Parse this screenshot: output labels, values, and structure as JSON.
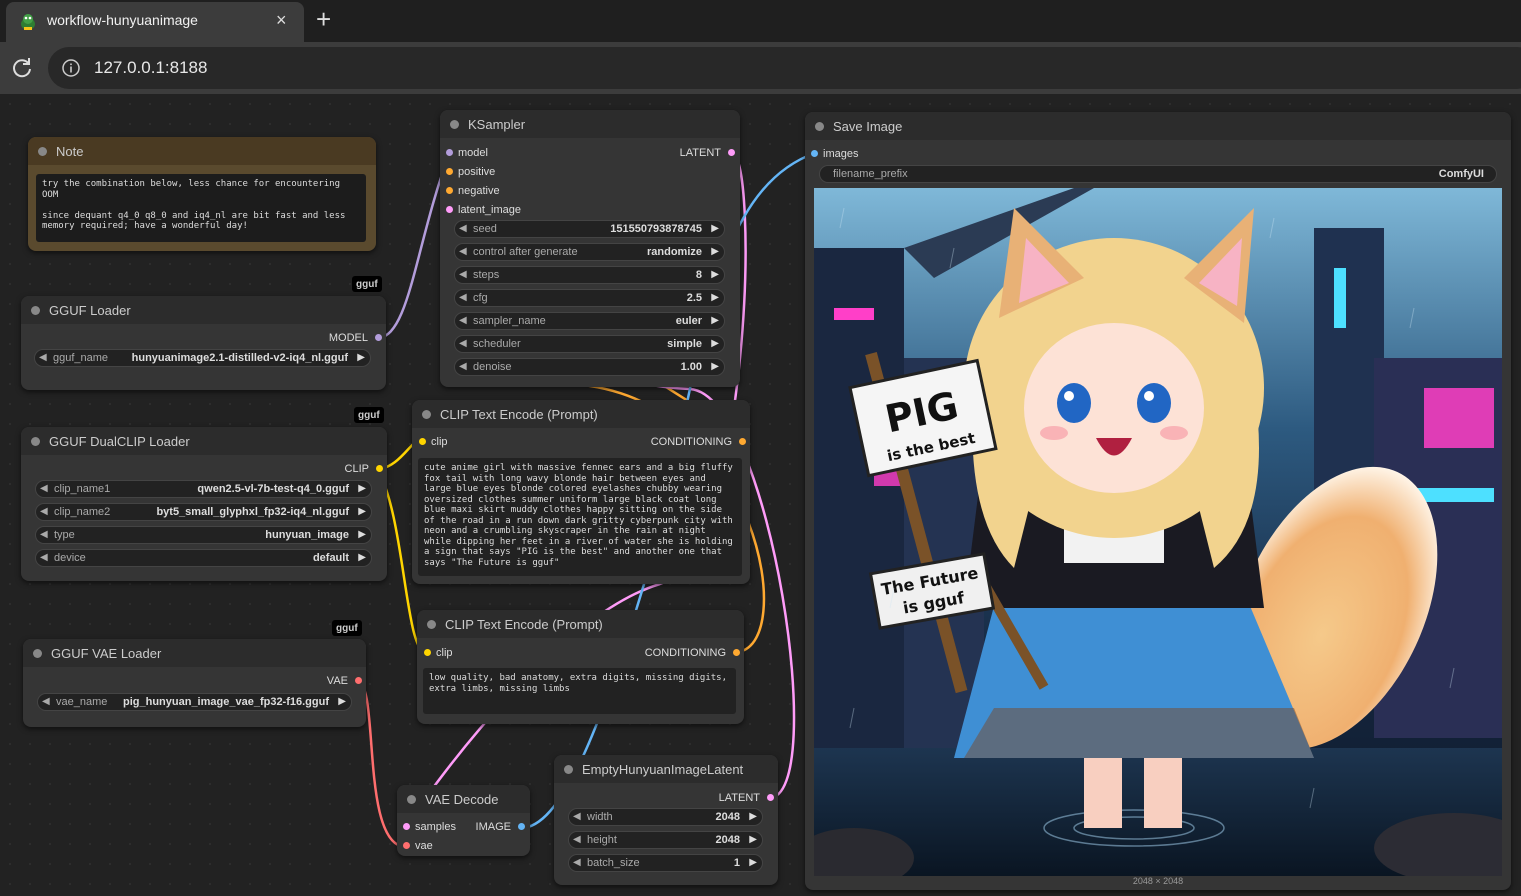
{
  "browser": {
    "tab_title": "workflow-hunyuanimage",
    "tab_close": "×",
    "new_tab": "+",
    "url": "127.0.0.1:8188"
  },
  "colors": {
    "model": "#b39ddb",
    "conditioning": "#ffa931",
    "clip": "#ffd500",
    "latent": "#ff9cf9",
    "vae": "#ff6e6e",
    "image": "#64b5f6"
  },
  "badge": "gguf",
  "note": {
    "title": "Note",
    "text": "try the combination below, less chance for encountering OOM\n\nsince dequant q4_0 q8_0 and iq4_nl are bit fast and less memory required; have a wonderful day!"
  },
  "gguf_loader": {
    "title": "GGUF Loader",
    "out": "MODEL",
    "widget": {
      "label": "gguf_name",
      "value": "hunyuanimage2.1-distilled-v2-iq4_nl.gguf"
    }
  },
  "dualclip": {
    "title": "GGUF DualCLIP Loader",
    "out": "CLIP",
    "widgets": [
      {
        "label": "clip_name1",
        "value": "qwen2.5-vl-7b-test-q4_0.gguf"
      },
      {
        "label": "clip_name2",
        "value": "byt5_small_glyphxl_fp32-iq4_nl.gguf"
      },
      {
        "label": "type",
        "value": "hunyuan_image"
      },
      {
        "label": "device",
        "value": "default"
      }
    ]
  },
  "vae_loader": {
    "title": "GGUF VAE Loader",
    "out": "VAE",
    "widget": {
      "label": "vae_name",
      "value": "pig_hunyuan_image_vae_fp32-f16.gguf"
    }
  },
  "ksampler": {
    "title": "KSampler",
    "inputs": [
      "model",
      "positive",
      "negative",
      "latent_image"
    ],
    "out": "LATENT",
    "widgets": [
      {
        "label": "seed",
        "value": "151550793878745"
      },
      {
        "label": "control after generate",
        "value": "randomize"
      },
      {
        "label": "steps",
        "value": "8"
      },
      {
        "label": "cfg",
        "value": "2.5"
      },
      {
        "label": "sampler_name",
        "value": "euler"
      },
      {
        "label": "scheduler",
        "value": "simple"
      },
      {
        "label": "denoise",
        "value": "1.00"
      }
    ]
  },
  "clip_pos": {
    "title": "CLIP Text Encode (Prompt)",
    "in": "clip",
    "out": "CONDITIONING",
    "text": "cute anime girl with massive fennec ears and a big fluffy fox tail with long wavy blonde hair between eyes and large blue eyes blonde colored eyelashes chubby wearing oversized clothes summer uniform large black coat long blue maxi skirt muddy clothes happy sitting on the side of the road in a run down dark gritty cyberpunk city with neon and a crumbling skyscraper in the rain at night while dipping her feet in a river of water she is holding a sign that says \"PIG is the best\" and another one that says \"The Future is gguf\""
  },
  "clip_neg": {
    "title": "CLIP Text Encode (Prompt)",
    "in": "clip",
    "out": "CONDITIONING",
    "text": "low quality, bad anatomy, extra digits, missing digits, extra limbs, missing limbs"
  },
  "vae_decode": {
    "title": "VAE Decode",
    "inputs": [
      "samples",
      "vae"
    ],
    "out": "IMAGE"
  },
  "empty_latent": {
    "title": "EmptyHunyuanImageLatent",
    "out": "LATENT",
    "widgets": [
      {
        "label": "width",
        "value": "2048"
      },
      {
        "label": "height",
        "value": "2048"
      },
      {
        "label": "batch_size",
        "value": "1"
      }
    ]
  },
  "save_image": {
    "title": "Save Image",
    "in": "images",
    "widget": {
      "label": "filename_prefix",
      "value": "ComfyUI"
    },
    "sign1_line1": "PIG",
    "sign1_line2": "is the best",
    "sign2_line1": "The Future",
    "sign2_line2": "is gguf",
    "dims": "2048 × 2048"
  }
}
